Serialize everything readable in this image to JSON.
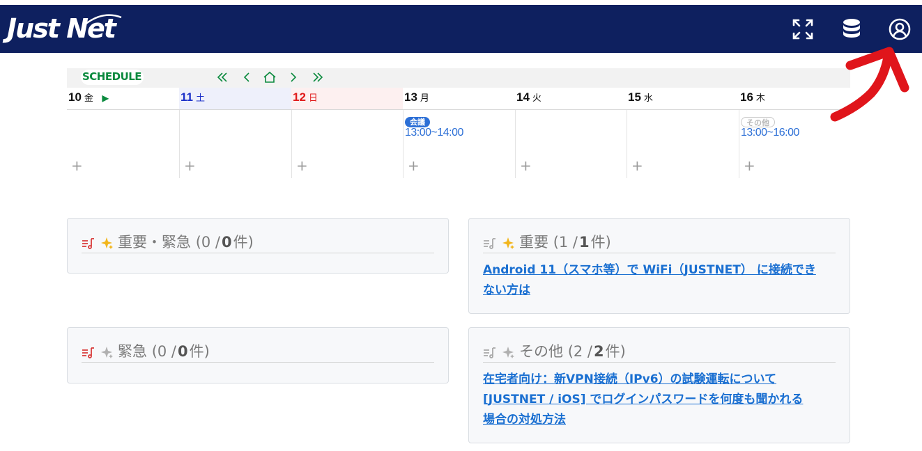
{
  "header": {
    "logo_text": "Just Net",
    "icons": [
      "fullscreen-icon",
      "database-icon",
      "account-icon"
    ],
    "bg_color": "#0e205f"
  },
  "schedule": {
    "label": "SCHEDULE",
    "nav": [
      "first",
      "prev",
      "home",
      "next",
      "last"
    ],
    "days": [
      {
        "num": "10",
        "wd": "金",
        "color": "#111111",
        "bg": "#ffffff",
        "marker": "▶"
      },
      {
        "num": "11",
        "wd": "土",
        "color": "#1a2fc8",
        "bg": "#eef0fb",
        "marker": ""
      },
      {
        "num": "12",
        "wd": "日",
        "color": "#e01b1b",
        "bg": "#fdf0f0",
        "marker": ""
      },
      {
        "num": "13",
        "wd": "月",
        "color": "#111111",
        "bg": "#ffffff",
        "marker": ""
      },
      {
        "num": "14",
        "wd": "火",
        "color": "#111111",
        "bg": "#ffffff",
        "marker": ""
      },
      {
        "num": "15",
        "wd": "水",
        "color": "#111111",
        "bg": "#ffffff",
        "marker": ""
      },
      {
        "num": "16",
        "wd": "木",
        "color": "#111111",
        "bg": "#ffffff",
        "marker": ""
      }
    ],
    "events": {
      "mon": {
        "tag": "会議",
        "time": "13:00~14:00"
      },
      "thu": {
        "tag": "その他",
        "time": "13:00~16:00"
      }
    },
    "add_symbol": "+"
  },
  "cards": {
    "important_urgent": {
      "title": "重要・緊急",
      "open": "(0 / ",
      "count": "0",
      "close": " 件)"
    },
    "important": {
      "title": "重要",
      "open": "(1 / ",
      "count": "1",
      "close": " 件)",
      "links": [
        "Android 11（スマホ等）で WiFi（JUSTNET） に接続でき",
        "ない方は"
      ]
    },
    "urgent": {
      "title": "緊急",
      "open": "(0 / ",
      "count": "0",
      "close": " 件)"
    },
    "other": {
      "title": "その他",
      "open": "(2 / ",
      "count": "2",
      "close": " 件)",
      "links": [
        "在宅者向け：新VPN接続（IPv6）の試験運転について",
        "[JUSTNET / iOS] でログインパスワードを何度も聞かれる",
        "場合の対処方法"
      ]
    }
  }
}
